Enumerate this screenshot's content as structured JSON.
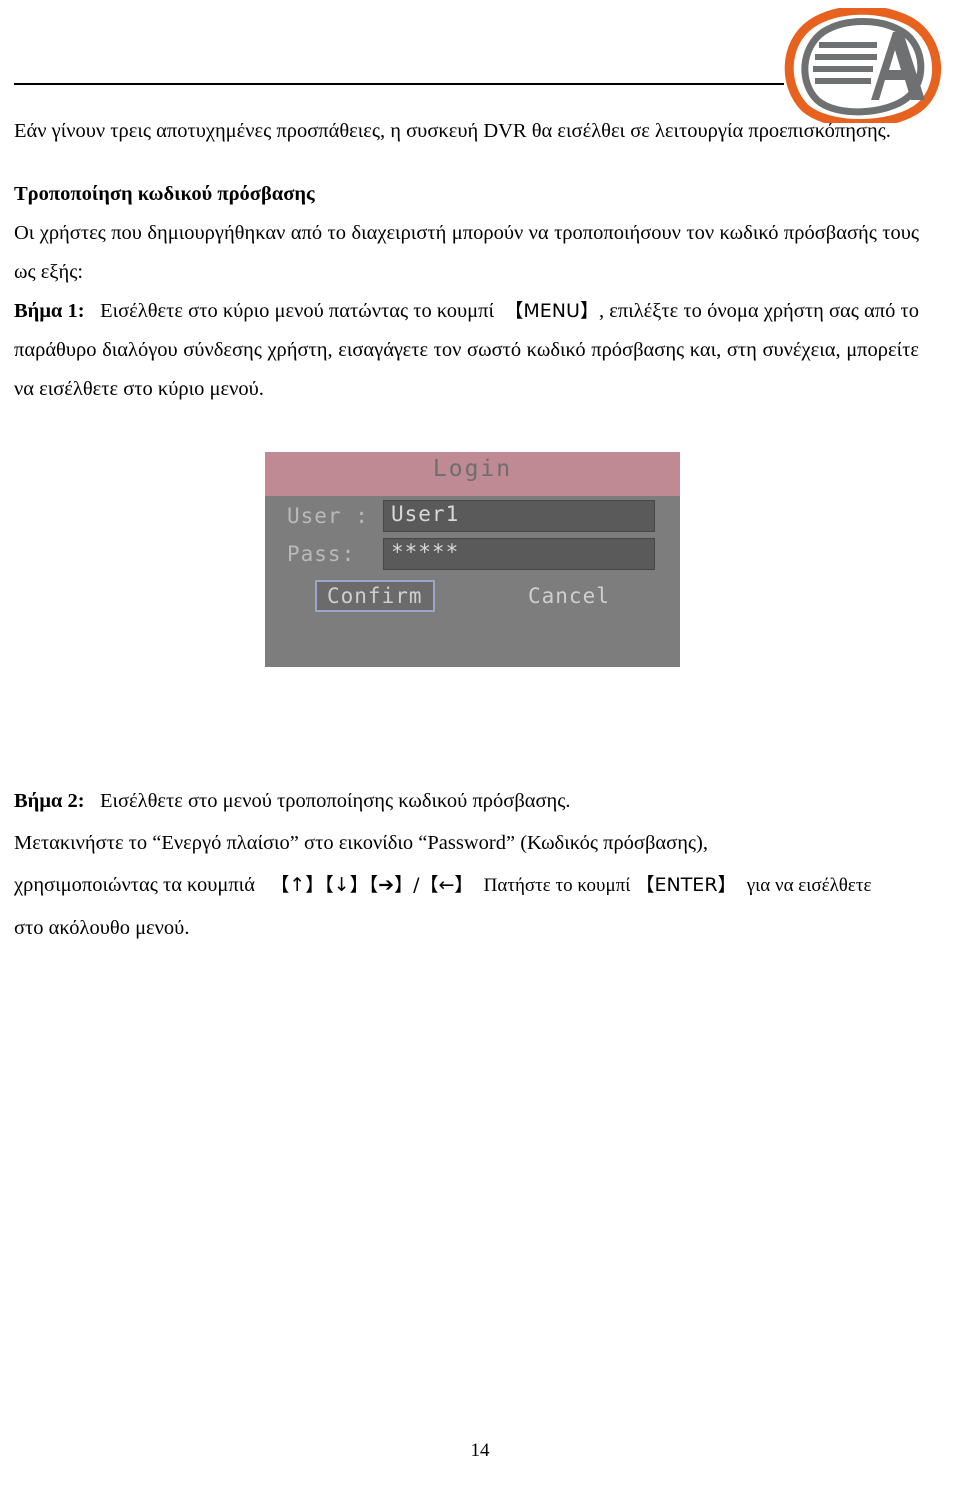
{
  "header": {
    "logo_letter": "A",
    "logo_alt": "company-logo"
  },
  "body": {
    "intro": "Εάν γίνουν τρεις αποτυχημένες προσπάθειες, η συσκευή DVR θα εισέλθει σε λειτουργία προεπισκόπησης.",
    "section_title": "Τροποποίηση κωδικού πρόσβασης",
    "section_lead": "Οι χρήστες που δημιουργήθηκαν από το διαχειριστή μπορούν να τροποποιήσουν τον κωδικό πρόσβασής τους ως εξής:",
    "step1_label": "Βήμα 1:",
    "step1_text_a": "Εισέλθετε στο κύριο μενού πατώντας το κουμπί",
    "step1_key": "【MENU】",
    "step1_text_b": ", επιλέξτε το όνομα χρήστη σας από το παράθυρο διαλόγου σύνδεσης χρήστη, εισαγάγετε τον σωστό κωδικό πρόσβασης και, στη συνέχεια, μπορείτε να εισέλθετε στο κύριο μενού."
  },
  "login_dialog": {
    "title": "Login",
    "user_label": "User :",
    "user_value": "User1",
    "pass_label": "Pass:",
    "pass_value": "*****",
    "confirm_label": "Confirm",
    "cancel_label": "Cancel"
  },
  "step2": {
    "label": "Βήμα 2:",
    "line1": "Εισέλθετε στο μενού τροποποίησης κωδικού πρόσβασης.",
    "line2": "Μετακινήστε το “Ενεργό πλαίσιο” στο εικονίδιο “Password” (Κωδικός πρόσβασης),",
    "line3_a": "χρησιμοποιώντας τα κουμπιά",
    "keys": "【↑】【↓】【➔】/【←】",
    "line3_b": "Πατήστε το κουμπί",
    "enter_key": "【ENTER】",
    "line3_c": "για να εισέλθετε",
    "line4": "στο ακόλουθο μενού."
  },
  "footer": {
    "page_number": "14"
  },
  "colors": {
    "logo_orange": "#e8621f",
    "logo_gray": "#6f7072",
    "dialog_titlebar": "#c08a95",
    "dialog_body": "#7d7d7d"
  }
}
